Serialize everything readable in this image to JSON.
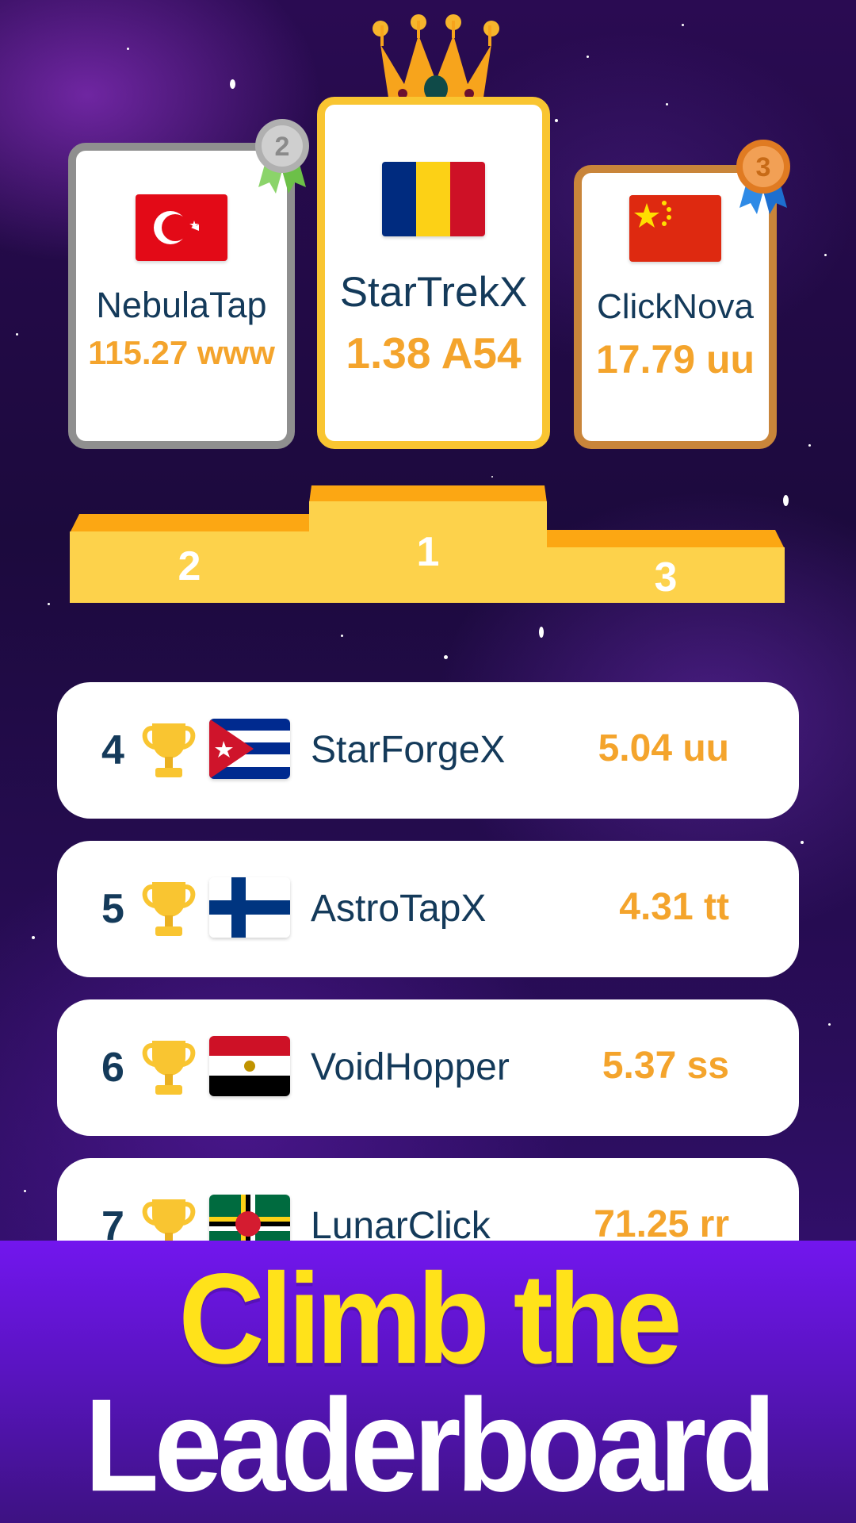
{
  "podium": {
    "first": {
      "position": "1",
      "name": "StarTrekX",
      "score": "1.38 A54",
      "flag": "romania-flag-icon"
    },
    "second": {
      "position": "2",
      "name": "NebulaTap",
      "score": "115.27 www",
      "flag": "turkey-flag-icon",
      "medal": "2"
    },
    "third": {
      "position": "3",
      "name": "ClickNova",
      "score": "17.79 uu",
      "flag": "china-flag-icon",
      "medal": "3"
    }
  },
  "rankings": [
    {
      "rank": "4",
      "name": "StarForgeX",
      "score": "5.04 uu",
      "flag": "cuba-flag-icon"
    },
    {
      "rank": "5",
      "name": "AstroTapX",
      "score": "4.31 tt",
      "flag": "finland-flag-icon"
    },
    {
      "rank": "6",
      "name": "VoidHopper",
      "score": "5.37 ss",
      "flag": "egypt-flag-icon"
    },
    {
      "rank": "7",
      "name": "LunarClick",
      "score": "71.25 rr",
      "flag": "dominica-flag-icon"
    }
  ],
  "banner": {
    "line1": "Climb the",
    "line2": "Leaderboard"
  },
  "colors": {
    "gold": "#f9c531",
    "silver": "#8f8f8f",
    "bronze": "#c9853a",
    "score": "#f4a42c",
    "name": "#143a5a",
    "banner_bg": "#6a14e0",
    "banner_title": "#ffe21a"
  }
}
